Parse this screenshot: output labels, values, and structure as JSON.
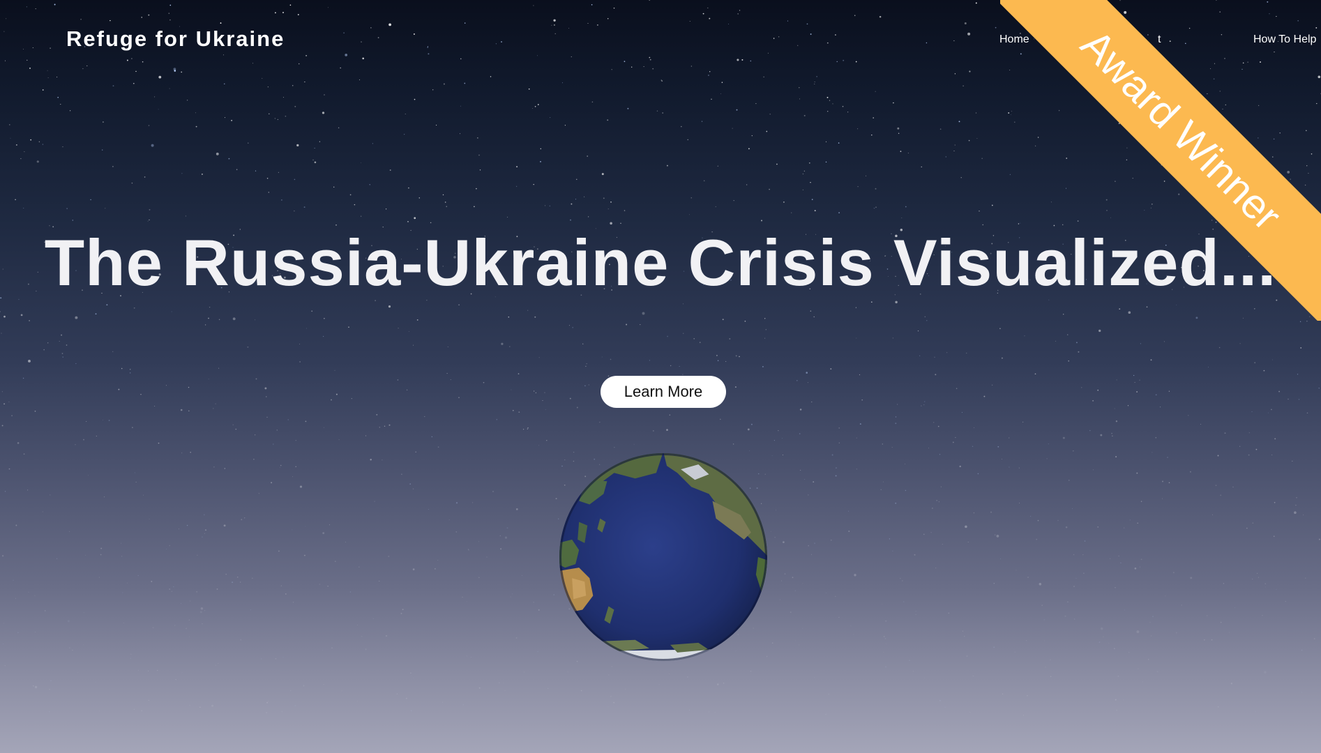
{
  "header": {
    "brand": "Refuge for Ukraine",
    "nav": {
      "home": "Home",
      "partial": "t",
      "help": "How To Help"
    }
  },
  "ribbon": {
    "label": "Award Winner",
    "color": "#fcb950"
  },
  "hero": {
    "title": "The Russia-Ukraine Crisis Visualized...",
    "button": "Learn More"
  },
  "globe": {
    "icon": "earth-globe-icon"
  }
}
